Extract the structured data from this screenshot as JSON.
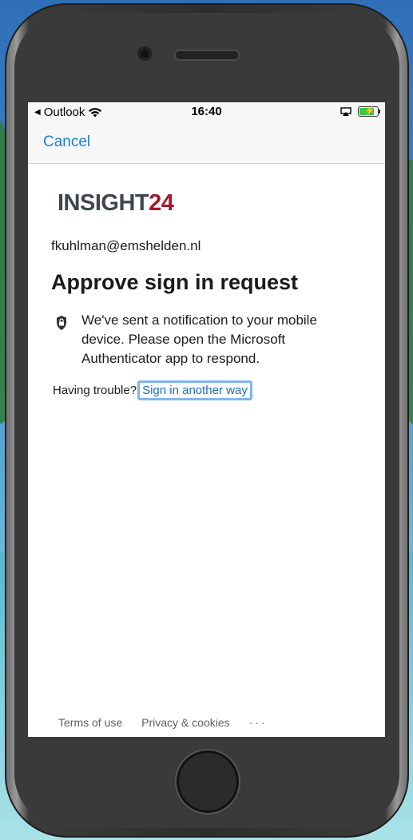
{
  "status_bar": {
    "back_app": "Outlook",
    "time": "16:40",
    "battery_level": 0.85
  },
  "nav": {
    "cancel_label": "Cancel"
  },
  "brand": {
    "logo_part1": "INSIGHT",
    "logo_part2": "24"
  },
  "signin": {
    "email": "fkuhlman@emshelden.nl",
    "title": "Approve sign in request",
    "description": "We've sent a notification to your mobile device. Please open the Microsoft Authenticator app to respond.",
    "trouble_text": "Having trouble?",
    "another_way_link": "Sign in another way"
  },
  "footer": {
    "terms": "Terms of use",
    "privacy": "Privacy & cookies",
    "more": "···"
  },
  "colors": {
    "link": "#1c7fd6",
    "logo_dark": "#3f4652",
    "logo_red": "#a3182b",
    "focus_ring": "#7fb6ee"
  },
  "icons": [
    "back-triangle-icon",
    "wifi-icon",
    "airplay-icon",
    "battery-charging-icon",
    "lock-shield-icon"
  ]
}
